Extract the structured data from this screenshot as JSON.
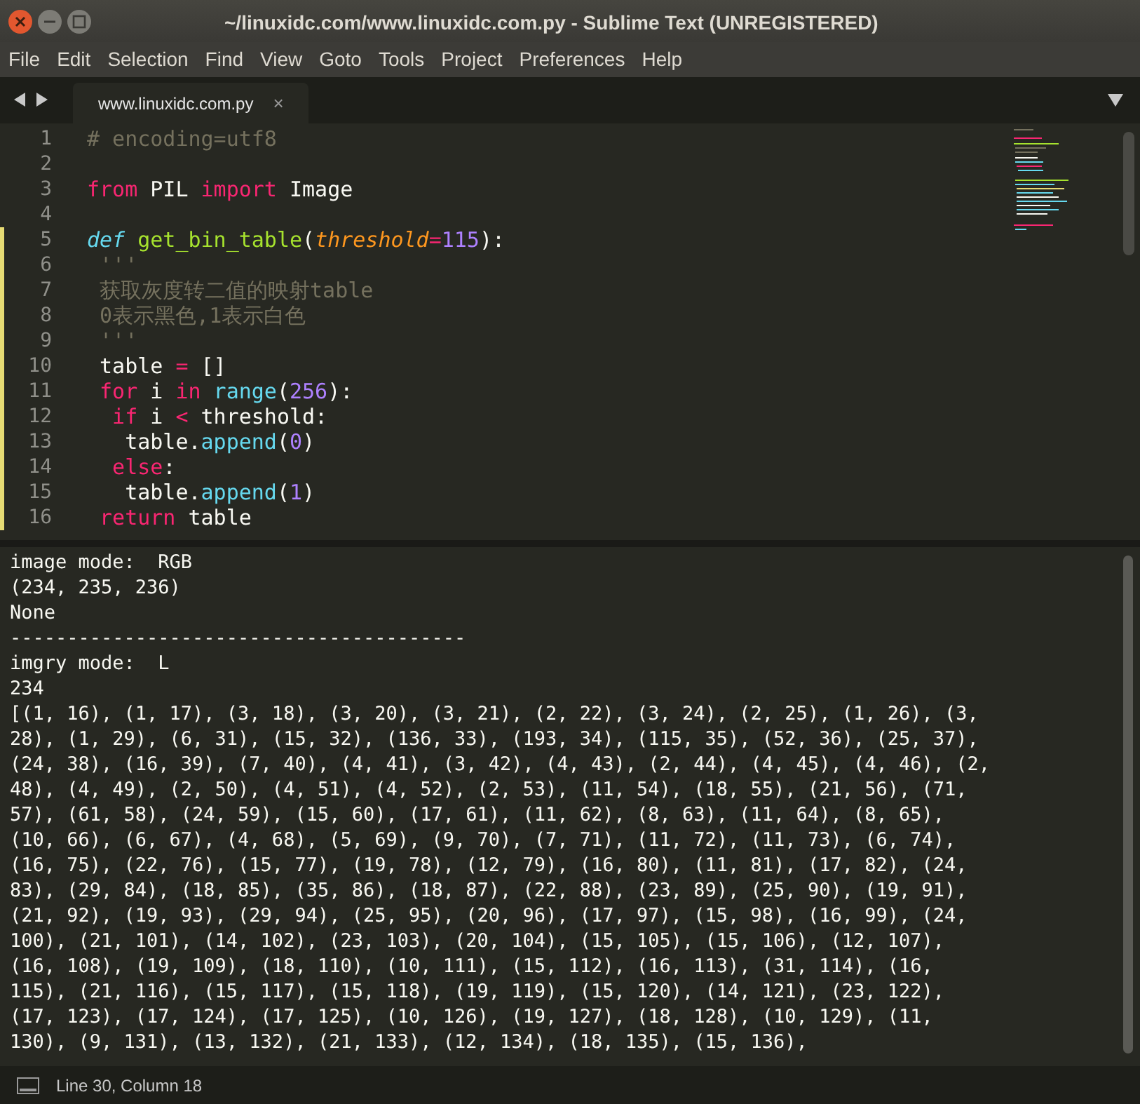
{
  "window": {
    "title": "~/linuxidc.com/www.linuxidc.com.py - Sublime Text (UNREGISTERED)"
  },
  "menu": [
    "File",
    "Edit",
    "Selection",
    "Find",
    "View",
    "Goto",
    "Tools",
    "Project",
    "Preferences",
    "Help"
  ],
  "tabs": [
    {
      "label": "www.linuxidc.com.py",
      "selected": true,
      "close": "×"
    }
  ],
  "editor": {
    "lines": [
      {
        "number": "1",
        "modified": false,
        "tokens": [
          {
            "t": "# encoding=utf8",
            "kind": "comment"
          }
        ]
      },
      {
        "number": "2",
        "modified": false
      },
      {
        "number": "3",
        "modified": false,
        "tokens": [
          {
            "t": "from",
            "kind": "keyword"
          },
          {
            "t": " PIL ",
            "kind": "plain"
          },
          {
            "t": "import",
            "kind": "keyword"
          },
          {
            "t": " Image",
            "kind": "plain"
          }
        ]
      },
      {
        "number": "4",
        "modified": false
      },
      {
        "number": "5",
        "modified": true,
        "tokens": [
          {
            "t": "def",
            "kind": "storage"
          },
          {
            "t": " get_bin_table",
            "kind": "function"
          },
          {
            "t": "(",
            "kind": "plain"
          },
          {
            "t": "threshold",
            "kind": "param"
          },
          {
            "t": "=",
            "kind": "keyword"
          },
          {
            "t": "115",
            "kind": "number"
          },
          {
            "t": "):",
            "kind": "plain"
          }
        ]
      },
      {
        "number": "6",
        "modified": true,
        "tokens": [
          {
            "t": " '''",
            "kind": "comment"
          }
        ]
      },
      {
        "number": "7",
        "modified": true,
        "tokens": [
          {
            "t": " 获取灰度转二值的映射table",
            "kind": "comment"
          }
        ]
      },
      {
        "number": "8",
        "modified": true,
        "tokens": [
          {
            "t": " 0表示黑色,1表示白色",
            "kind": "comment"
          }
        ]
      },
      {
        "number": "9",
        "modified": true,
        "tokens": [
          {
            "t": " '''",
            "kind": "comment"
          }
        ]
      },
      {
        "number": "10",
        "modified": true,
        "tokens": [
          {
            "t": " table ",
            "kind": "plain"
          },
          {
            "t": "=",
            "kind": "keyword"
          },
          {
            "t": " []",
            "kind": "plain"
          }
        ]
      },
      {
        "number": "11",
        "modified": true,
        "tokens": [
          {
            "t": " for",
            "kind": "keyword"
          },
          {
            "t": " i ",
            "kind": "plain"
          },
          {
            "t": "in",
            "kind": "keyword"
          },
          {
            "t": " range",
            "kind": "builtin"
          },
          {
            "t": "(",
            "kind": "plain"
          },
          {
            "t": "256",
            "kind": "number"
          },
          {
            "t": "):",
            "kind": "plain"
          }
        ]
      },
      {
        "number": "12",
        "modified": true,
        "tokens": [
          {
            "t": "  if",
            "kind": "keyword"
          },
          {
            "t": " i ",
            "kind": "plain"
          },
          {
            "t": "<",
            "kind": "keyword"
          },
          {
            "t": " threshold:",
            "kind": "plain"
          }
        ]
      },
      {
        "number": "13",
        "modified": true,
        "tokens": [
          {
            "t": "   table.",
            "kind": "plain"
          },
          {
            "t": "append",
            "kind": "builtin"
          },
          {
            "t": "(",
            "kind": "plain"
          },
          {
            "t": "0",
            "kind": "number"
          },
          {
            "t": ")",
            "kind": "plain"
          }
        ]
      },
      {
        "number": "14",
        "modified": true,
        "tokens": [
          {
            "t": "  else",
            "kind": "keyword"
          },
          {
            "t": ":",
            "kind": "plain"
          }
        ]
      },
      {
        "number": "15",
        "modified": true,
        "tokens": [
          {
            "t": "   table.",
            "kind": "plain"
          },
          {
            "t": "append",
            "kind": "builtin"
          },
          {
            "t": "(",
            "kind": "plain"
          },
          {
            "t": "1",
            "kind": "number"
          },
          {
            "t": ")",
            "kind": "plain"
          }
        ]
      },
      {
        "number": "16",
        "modified": true,
        "tokens": [
          {
            "t": " return",
            "kind": "keyword"
          },
          {
            "t": " table",
            "kind": "plain"
          }
        ]
      }
    ]
  },
  "output": {
    "lines": [
      "image mode:  RGB",
      "(234, 235, 236)",
      "None",
      "----------------------------------------",
      "imgry mode:  L",
      "234",
      "[(1, 16), (1, 17), (3, 18), (3, 20), (3, 21), (2, 22), (3, 24), (2, 25), (1, 26), (3,",
      "28), (1, 29), (6, 31), (15, 32), (136, 33), (193, 34), (115, 35), (52, 36), (25, 37),",
      "(24, 38), (16, 39), (7, 40), (4, 41), (3, 42), (4, 43), (2, 44), (4, 45), (4, 46), (2,",
      "48), (4, 49), (2, 50), (4, 51), (4, 52), (2, 53), (11, 54), (18, 55), (21, 56), (71,",
      "57), (61, 58), (24, 59), (15, 60), (17, 61), (11, 62), (8, 63), (11, 64), (8, 65),",
      "(10, 66), (6, 67), (4, 68), (5, 69), (9, 70), (7, 71), (11, 72), (11, 73), (6, 74),",
      "(16, 75), (22, 76), (15, 77), (19, 78), (12, 79), (16, 80), (11, 81), (17, 82), (24,",
      "83), (29, 84), (18, 85), (35, 86), (18, 87), (22, 88), (23, 89), (25, 90), (19, 91),",
      "(21, 92), (19, 93), (29, 94), (25, 95), (20, 96), (17, 97), (15, 98), (16, 99), (24,",
      "100), (21, 101), (14, 102), (23, 103), (20, 104), (15, 105), (15, 106), (12, 107),",
      "(16, 108), (19, 109), (18, 110), (10, 111), (15, 112), (16, 113), (31, 114), (16,",
      "115), (21, 116), (15, 117), (15, 118), (19, 119), (15, 120), (14, 121), (23, 122),",
      "(17, 123), (17, 124), (17, 125), (10, 126), (19, 127), (18, 128), (10, 129), (11,",
      "130), (9, 131), (13, 132), (21, 133), (12, 134), (18, 135), (15, 136),"
    ]
  },
  "status_bar": {
    "position": "Line 30, Column 18"
  }
}
